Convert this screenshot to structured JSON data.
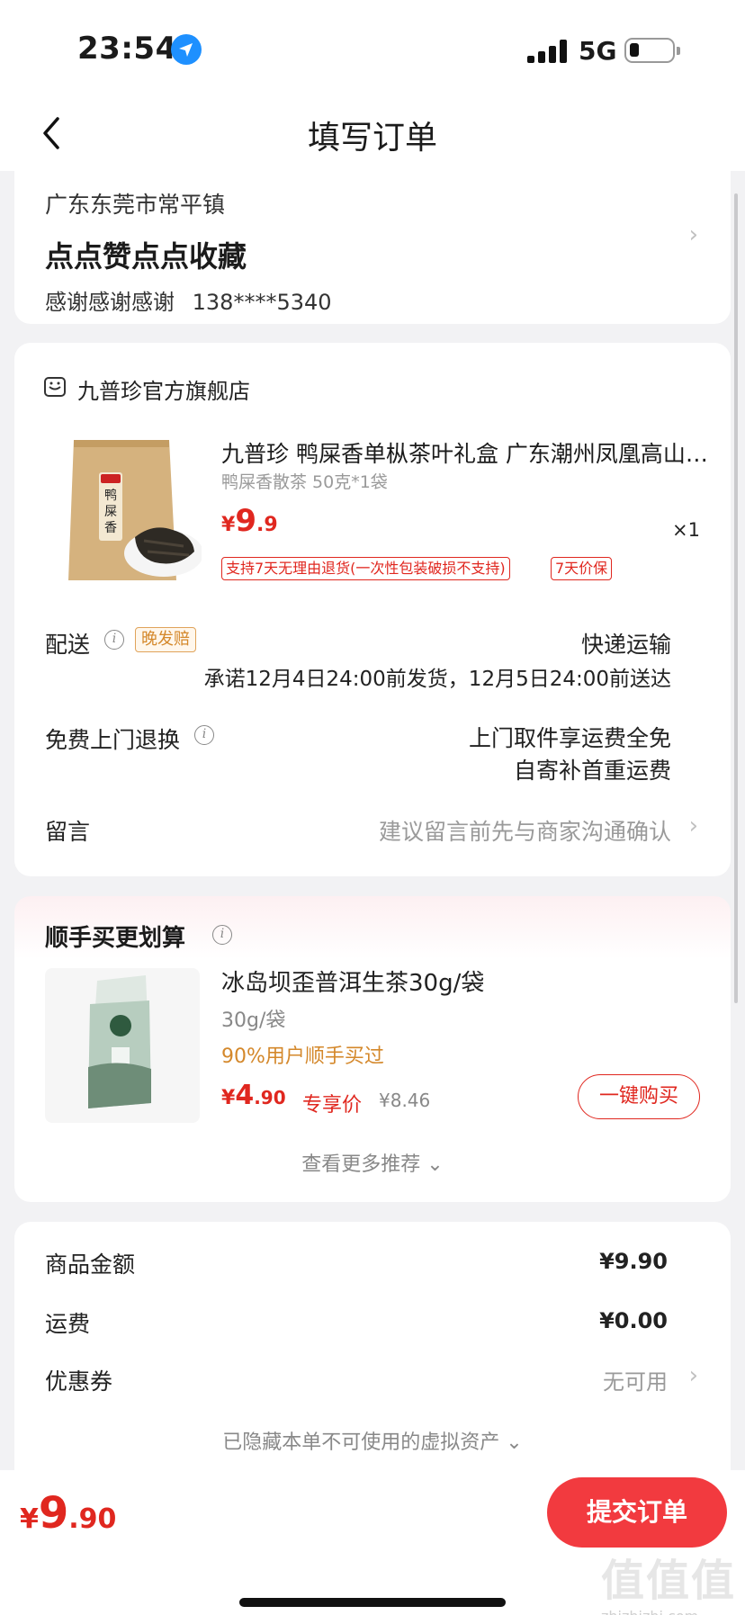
{
  "status_bar": {
    "time": "23:54",
    "network": "5G"
  },
  "nav": {
    "title": "填写订单"
  },
  "address": {
    "region": "广东东莞市常平镇",
    "detail": "点点赞点点收藏",
    "contact_name": "感谢感谢感谢",
    "contact_phone": "138****5340"
  },
  "order": {
    "shop_name": "九普珍官方旗舰店",
    "product": {
      "title": "九普珍 鸭屎香单枞茶叶礼盒 广东潮州凤凰高山乌岽正宗单丛茶",
      "spec": "鸭屎香散茶 50克*1袋",
      "currency": "¥",
      "price_int": "9",
      "price_dec": ".9",
      "quantity": "×1",
      "img_label": "鸭屎香",
      "tags": [
        "支持7天无理由退货(一次性包装破损不支持)",
        "7天价保"
      ]
    },
    "delivery": {
      "label": "配送",
      "badge": "晚发赔",
      "method": "快递运输",
      "promise": "承诺12月4日24:00前发货，12月5日24:00前送达"
    },
    "return": {
      "label": "免费上门退换",
      "line1": "上门取件享运费全免",
      "line2": "自寄补首重运费"
    },
    "message": {
      "label": "留言",
      "placeholder": "建议留言前先与商家沟通确认"
    }
  },
  "recommend": {
    "title": "顺手买更划算",
    "item": {
      "name": "冰岛坝歪普洱生茶30g/袋",
      "spec": "30g/袋",
      "bought": "90%用户顺手买过",
      "currency": "¥",
      "price_int": "4",
      "price_dec": ".90",
      "exclusive": "专享价",
      "original": "¥8.46",
      "buy_label": "一键购买"
    },
    "more_label": "查看更多推荐"
  },
  "summary": {
    "goods_label": "商品金额",
    "goods_value": "¥9.90",
    "shipping_label": "运费",
    "shipping_value": "¥0.00",
    "coupon_label": "优惠券",
    "coupon_value": "无可用",
    "hidden_label": "已隐藏本单不可使用的虚拟资产"
  },
  "footer": {
    "currency": "¥",
    "total_int": "9",
    "total_dec": ".90",
    "submit_label": "提交订单"
  },
  "watermark": {
    "logo": "值值值",
    "url": "zhizhizhi.com"
  },
  "colors": {
    "accent": "#e0271f",
    "submit": "#f23a3f",
    "badge_orange": "#d4882b"
  }
}
